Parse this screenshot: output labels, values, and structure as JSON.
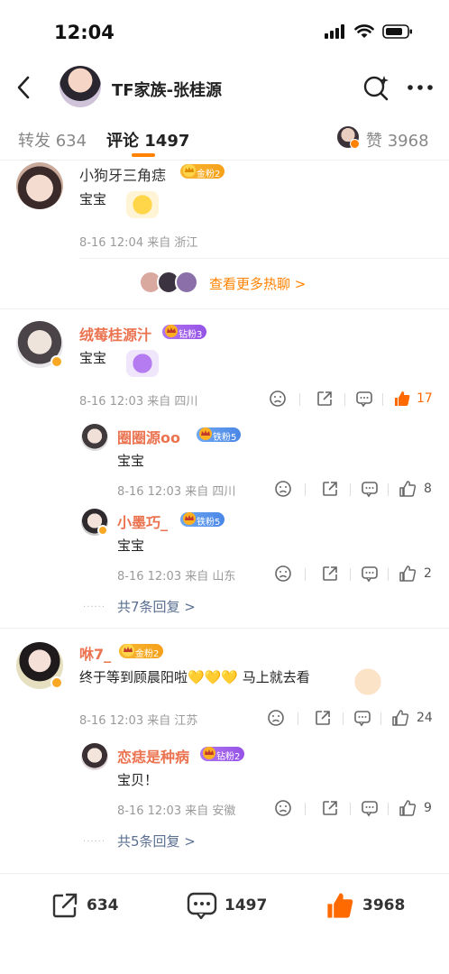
{
  "status_bar": {
    "time": "12:04"
  },
  "nav": {
    "title": "TF家族-张桂源"
  },
  "tabs": {
    "repost": "转发 634",
    "comments": "评论 1497",
    "likes": "赞 3968"
  },
  "hot_more": "查看更多热聊 >",
  "comments": [
    {
      "name": "小狗牙三角痣",
      "badge": "金粉2",
      "text": "宝宝",
      "meta": "8-16 12:04  来自 浙江"
    },
    {
      "name": "绒莓桂源汁",
      "badge": "钻粉3",
      "text": "宝宝",
      "meta": "8-16 12:03  来自 四川",
      "likes": "17",
      "replies": [
        {
          "name": "圈圈源oo",
          "badge": "铁粉5",
          "text": "宝宝",
          "meta": "8-16 12:03  来自 四川",
          "likes": "8"
        },
        {
          "name": "小墨巧_",
          "badge": "铁粉5",
          "text": "宝宝",
          "meta": "8-16 12:03  来自 山东",
          "likes": "2"
        }
      ],
      "more_replies": "共7条回复 >"
    },
    {
      "name": "咻7_",
      "badge": "金粉2",
      "text": "终于等到顾晨阳啦💛💛💛 马上就去看",
      "meta": "8-16 12:03  来自 江苏",
      "likes": "24",
      "replies": [
        {
          "name": "恋痣是种病",
          "badge": "钻粉2",
          "text": "宝贝！",
          "meta": "8-16 12:03  来自 安徽",
          "likes": "9"
        }
      ],
      "more_replies": "共5条回复 >"
    }
  ],
  "bottom_bar": {
    "repost": "634",
    "comments": "1497",
    "likes": "3968"
  },
  "colors": {
    "accent": "#ff8200",
    "name_orange": "#eb7350",
    "link": "#5a6f92"
  }
}
